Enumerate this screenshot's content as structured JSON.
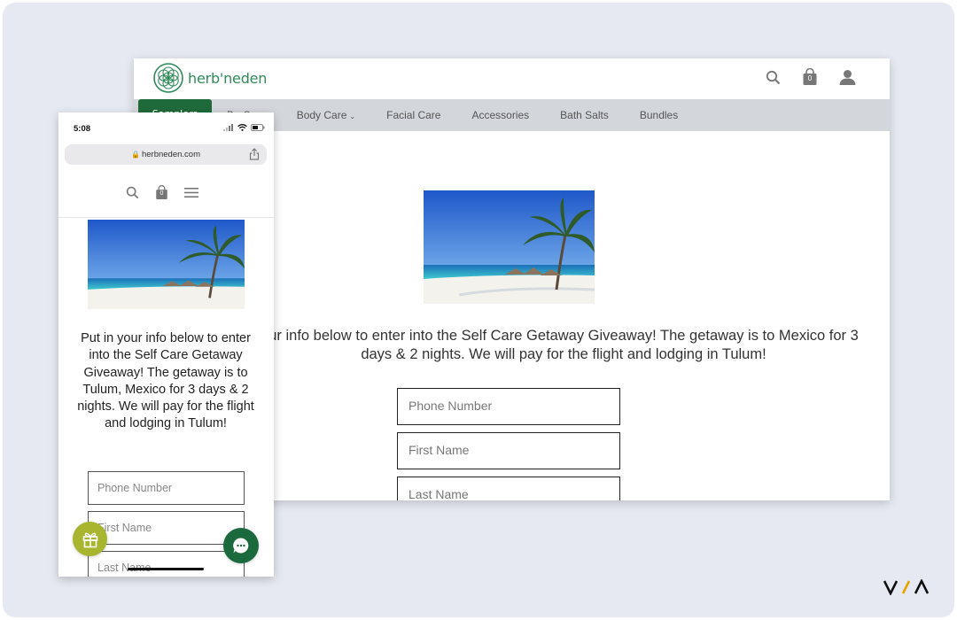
{
  "desktop": {
    "logo_text": "herb'neden",
    "header_icons": [
      "search-icon",
      "bag-icon",
      "user-icon"
    ],
    "bag_count": "0",
    "nav": {
      "active_label": "Samplers",
      "items": [
        {
          "label": "BarSoap"
        },
        {
          "label": "Body Care",
          "has_dropdown": true
        },
        {
          "label": "Facial Care"
        },
        {
          "label": "Accessories"
        },
        {
          "label": "Bath Salts"
        },
        {
          "label": "Bundles"
        }
      ]
    },
    "intro_text": "ur info below to enter into the Self Care Getaway Giveaway! The getaway is to Mexico for 3 days & 2 nights. We will pay for the flight and lodging in Tulum!",
    "fields": {
      "phone": "Phone Number",
      "first": "First Name",
      "last": "Last Name"
    }
  },
  "mobile": {
    "time": "5:08",
    "url": "herbneden.com",
    "bag_count": "0",
    "header_icons": [
      "search-icon",
      "bag-icon",
      "menu-icon"
    ],
    "intro_text": "Put in your info below to enter into the Self Care Getaway Giveaway! The getaway is to Tulum, Mexico for 3 days & 2 nights. We will pay for the flight and lodging in Tulum!",
    "fields": {
      "phone": "Phone Number",
      "first": "First Name",
      "last": "Last Name"
    }
  },
  "floating": {
    "gift_icon": "gift-icon",
    "chat_icon": "chat-icon"
  },
  "colors": {
    "brand_green": "#2f8a58",
    "nav_active": "#1f6a3a",
    "nav_bg": "#d3d6db",
    "gift_bg": "#a8b52e",
    "chat_bg": "#1b6a3e",
    "background": "#e6e9f1"
  }
}
